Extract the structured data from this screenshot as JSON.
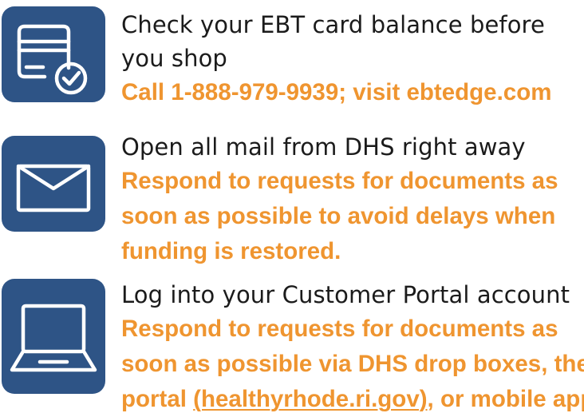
{
  "items": [
    {
      "icon": "credit-card-check-icon",
      "heading_lines": [
        "Check your EBT card balance before",
        "you shop"
      ],
      "body_lines": [
        "Call 1-888-979-9939; visit ebtedge.com"
      ]
    },
    {
      "icon": "envelope-icon",
      "heading_lines": [
        "Open all mail from DHS right away"
      ],
      "body_lines": [
        "Respond to requests for documents as",
        "soon as possible to avoid delays when",
        "funding is restored."
      ]
    },
    {
      "icon": "laptop-icon",
      "heading_lines": [
        "Log into your Customer Portal account"
      ],
      "body_lines": [
        "Respond to requests for documents as",
        "soon as possible via DHS drop boxes, the"
      ],
      "body_last": {
        "prefix": "portal ",
        "link": "(healthyrhode.ri.gov)",
        "suffix": ", or mobile app"
      }
    }
  ],
  "colors": {
    "icon_bg": "#2e5486",
    "heading": "#1b1b1b",
    "accent": "#ef9530"
  }
}
